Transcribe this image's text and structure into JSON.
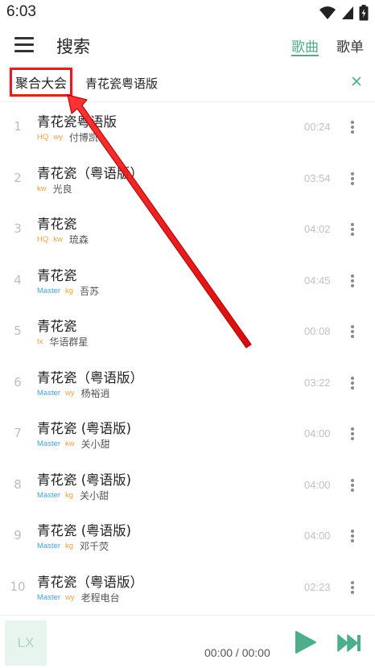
{
  "status_bar": {
    "time": "6:03"
  },
  "header": {
    "title": "搜索",
    "tabs": [
      {
        "label": "歌曲",
        "active": true
      },
      {
        "label": "歌单",
        "active": false
      }
    ]
  },
  "search": {
    "source_label": "聚合大会",
    "query": "青花瓷粤语版"
  },
  "songs": [
    {
      "index": "1",
      "title": "青花瓷粤语版",
      "tags": [
        "HQ",
        "wy"
      ],
      "artist": "付博凯",
      "duration": "00:24"
    },
    {
      "index": "2",
      "title": "青花瓷（粤语版）",
      "tags": [
        "kw"
      ],
      "artist": "光良",
      "duration": "03:54"
    },
    {
      "index": "3",
      "title": "青花瓷",
      "tags": [
        "HQ",
        "kw"
      ],
      "artist": "琉森",
      "duration": "04:02"
    },
    {
      "index": "4",
      "title": "青花瓷",
      "tags": [
        "Master",
        "kg"
      ],
      "artist": "吾苏",
      "duration": "04:45"
    },
    {
      "index": "5",
      "title": "青花瓷",
      "tags": [
        "tx"
      ],
      "artist": "华语群星",
      "duration": "00:08"
    },
    {
      "index": "6",
      "title": "青花瓷（粤语版）",
      "tags": [
        "Master",
        "wy"
      ],
      "artist": "杨裕逍",
      "duration": "03:22"
    },
    {
      "index": "7",
      "title": "青花瓷 (粤语版)",
      "tags": [
        "Master",
        "kw"
      ],
      "artist": "关小甜",
      "duration": "04:00"
    },
    {
      "index": "8",
      "title": "青花瓷 (粤语版)",
      "tags": [
        "Master",
        "kg"
      ],
      "artist": "关小甜",
      "duration": "04:00"
    },
    {
      "index": "9",
      "title": "青花瓷 (粤语版)",
      "tags": [
        "Master",
        "kg"
      ],
      "artist": "邓千荧",
      "duration": "04:00"
    },
    {
      "index": "10",
      "title": "青花瓷（粤语版）",
      "tags": [
        "Master",
        "wy"
      ],
      "artist": "老程电台",
      "duration": "02:23"
    }
  ],
  "player": {
    "cover_text": "LX",
    "time": "00:00 / 00:00"
  },
  "colors": {
    "accent": "#4caf8a",
    "tag_hq": "#f0a040",
    "tag_master": "#4aa0d8",
    "tag_source": "#e6a23c",
    "highlight": "#e02020"
  },
  "icons": [
    "menu-icon",
    "clear-icon",
    "more-vert-icon",
    "play-icon",
    "skip-next-icon",
    "wifi-icon",
    "signal-icon",
    "battery-icon"
  ]
}
